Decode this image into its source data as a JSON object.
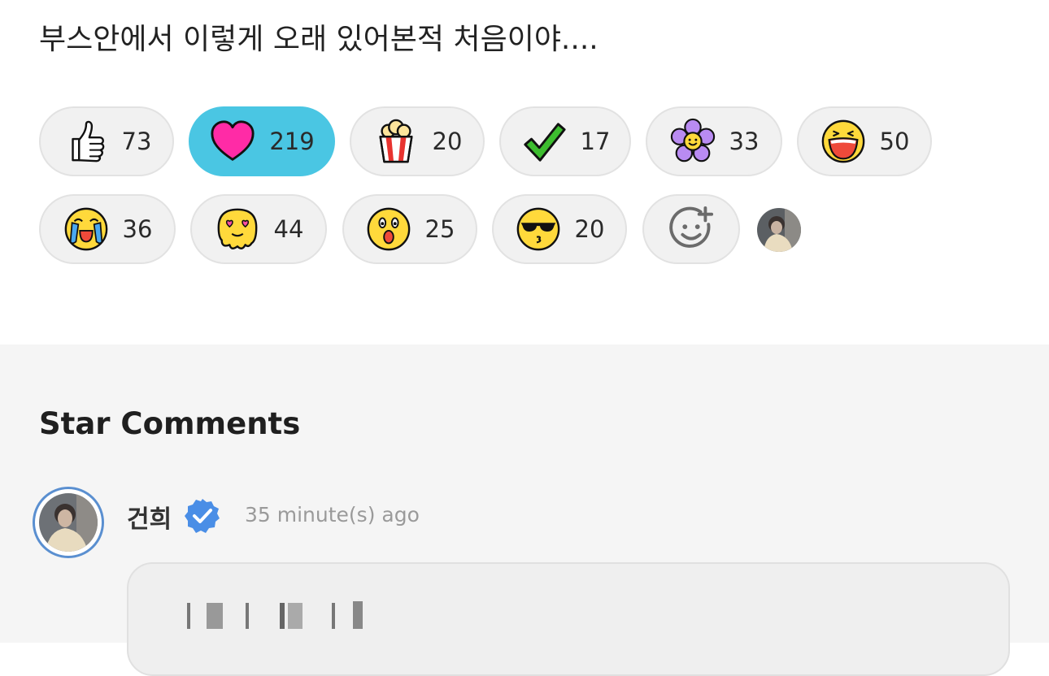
{
  "post": {
    "text": "부스안에서 이렇게 오래 있어본적 처음이야...."
  },
  "reactions": [
    {
      "icon": "thumbs-up-icon",
      "count": "73"
    },
    {
      "icon": "heart-icon",
      "count": "219",
      "selected": true
    },
    {
      "icon": "popcorn-icon",
      "count": "20"
    },
    {
      "icon": "check-icon",
      "count": "17"
    },
    {
      "icon": "flower-icon",
      "count": "33"
    },
    {
      "icon": "laughing-face-icon",
      "count": "50"
    },
    {
      "icon": "crying-face-icon",
      "count": "36"
    },
    {
      "icon": "heart-eyes-melting-icon",
      "count": "44"
    },
    {
      "icon": "surprised-face-icon",
      "count": "25"
    },
    {
      "icon": "sunglasses-kiss-icon",
      "count": "20"
    }
  ],
  "add_reaction": {
    "icon": "add-reaction-icon"
  },
  "colors": {
    "selected_chip": "#4ac6e3",
    "heart": "#ff2ba6",
    "verified": "#4a8ee6",
    "avatar_ring": "#5a8fd0"
  },
  "comments_section": {
    "title": "Star Comments",
    "comment": {
      "author": "건희",
      "verified_icon": "verified-badge-icon",
      "time": "35 minute(s) ago"
    }
  }
}
